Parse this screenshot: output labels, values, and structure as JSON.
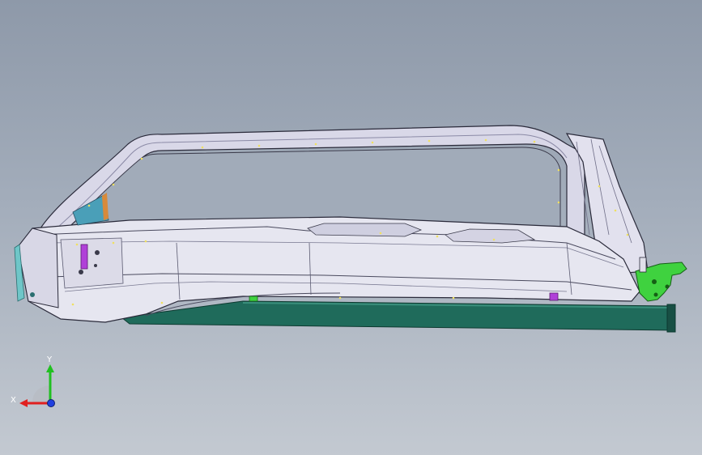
{
  "viewport": {
    "background_top": "#8e99a9",
    "background_bottom": "#c3c9d1"
  },
  "model": {
    "body_color": "#e6e6f0",
    "sill_color": "#1f6b5b",
    "hinge_color": "#3fd23f",
    "clip_color": "#b040d8",
    "edge_color": "#2a2a3a",
    "weld_point_color": "#f0e060"
  },
  "triad": {
    "x_label": "X",
    "y_label": "Y",
    "x_color": "#e02020",
    "y_color": "#20c020",
    "z_color": "#2040e0"
  }
}
